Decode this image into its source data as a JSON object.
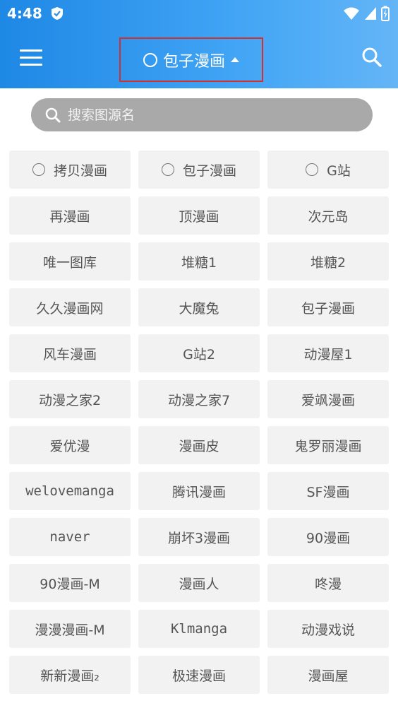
{
  "status_bar": {
    "time": "4:48"
  },
  "app_bar": {
    "title": "包子漫画"
  },
  "search": {
    "placeholder": "搜索图源名"
  },
  "grid": [
    {
      "label": "拷贝漫画",
      "radio": true
    },
    {
      "label": "包子漫画",
      "radio": true
    },
    {
      "label": "G站",
      "radio": true
    },
    {
      "label": "再漫画"
    },
    {
      "label": "顶漫画"
    },
    {
      "label": "次元岛"
    },
    {
      "label": "唯一图库"
    },
    {
      "label": "堆糖1"
    },
    {
      "label": "堆糖2"
    },
    {
      "label": "久久漫画网"
    },
    {
      "label": "大魔兔"
    },
    {
      "label": "包子漫画"
    },
    {
      "label": "风车漫画"
    },
    {
      "label": "G站2"
    },
    {
      "label": "动漫屋1"
    },
    {
      "label": "动漫之家2"
    },
    {
      "label": "动漫之家7"
    },
    {
      "label": "爱飒漫画"
    },
    {
      "label": "爱优漫"
    },
    {
      "label": "漫画皮"
    },
    {
      "label": "鬼罗丽漫画"
    },
    {
      "label": "welovemanga",
      "mono": true
    },
    {
      "label": "腾讯漫画"
    },
    {
      "label": "SF漫画"
    },
    {
      "label": "naver",
      "mono": true
    },
    {
      "label": "崩坏3漫画"
    },
    {
      "label": "90漫画"
    },
    {
      "label": "90漫画-M"
    },
    {
      "label": "漫画人"
    },
    {
      "label": "咚漫"
    },
    {
      "label": "漫漫漫画-M"
    },
    {
      "label": "Klmanga",
      "mono": true
    },
    {
      "label": "动漫戏说"
    },
    {
      "label": "新新漫画₂"
    },
    {
      "label": "极速漫画"
    },
    {
      "label": "漫画屋"
    }
  ]
}
